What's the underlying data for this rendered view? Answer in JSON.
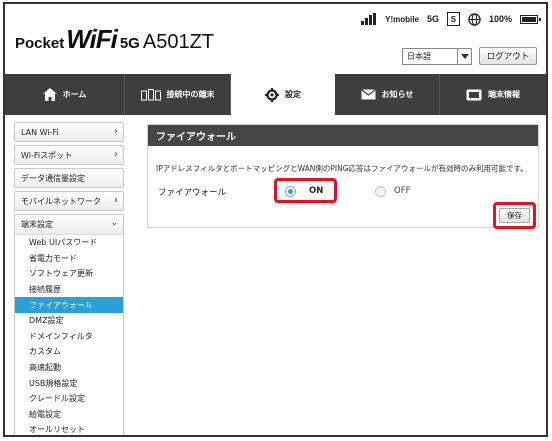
{
  "header": {
    "logo_pocket": "Pocket",
    "logo_wifi": "WiFi",
    "logo_5g": "5G",
    "logo_model": "A501ZT",
    "carrier": "Y!mobile",
    "network": "5G",
    "sim": "S",
    "battery": "100%",
    "language": "日本語",
    "logout_label": "ログアウト"
  },
  "nav": {
    "items": [
      {
        "label": "ホーム",
        "icon": "home-icon"
      },
      {
        "label": "接続中の端末",
        "icon": "devices-icon"
      },
      {
        "label": "設定",
        "icon": "gear-icon"
      },
      {
        "label": "お知らせ",
        "icon": "mail-icon"
      },
      {
        "label": "端末情報",
        "icon": "device-info-icon"
      }
    ],
    "active_index": 2
  },
  "sidebar": {
    "items": [
      {
        "label": "LAN Wi-Fi"
      },
      {
        "label": "Wi-Fiスポット"
      },
      {
        "label": "データ通信量設定"
      },
      {
        "label": "モバイルネットワーク"
      }
    ],
    "group": {
      "label": "端末設定",
      "subitems": [
        {
          "label": "Web UIパスワード"
        },
        {
          "label": "省電力モード"
        },
        {
          "label": "ソフトウェア更新"
        },
        {
          "label": "接続履歴"
        },
        {
          "label": "ファイアウォール"
        },
        {
          "label": "DMZ設定"
        },
        {
          "label": "ドメインフィルタ"
        },
        {
          "label": "カスタム"
        },
        {
          "label": "高速起動"
        },
        {
          "label": "USB規格設定"
        },
        {
          "label": "クレードル設定"
        },
        {
          "label": "給電設定"
        },
        {
          "label": "オールリセット"
        }
      ],
      "active_index": 4
    }
  },
  "main": {
    "title": "ファイアウォール",
    "note": "IPアドレスフィルタとポートマッピングとWAN側のPING応答はファイアウォールが有効時のみ利用可能です。",
    "field_label": "ファイアウォール",
    "on_label": "ON",
    "off_label": "OFF",
    "selected": "ON",
    "save_label": "保存"
  },
  "colors": {
    "nav_bg": "#3e3e3e",
    "accent": "#2a9fd8",
    "highlight": "#e8101e"
  }
}
